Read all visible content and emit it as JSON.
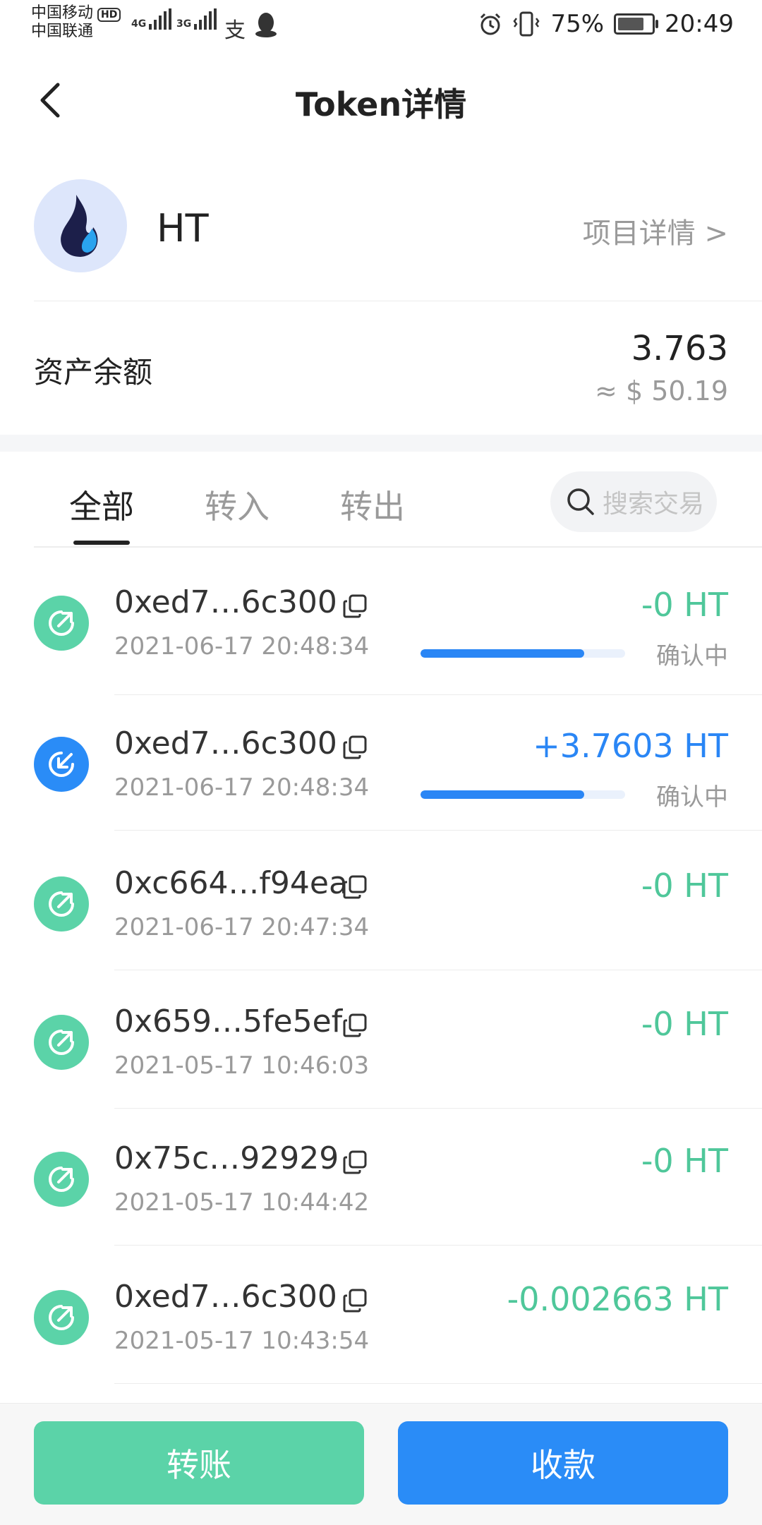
{
  "status_bar": {
    "carrier1": "中国移动",
    "carrier2": "中国联通",
    "hd": "HD",
    "net1": "4G",
    "net2": "3G",
    "battery": "75%",
    "time": "20:49"
  },
  "header": {
    "title": "Token详情"
  },
  "token": {
    "name": "HT",
    "project_link": "项目详情 >",
    "balance_label": "资产余额",
    "balance": "3.763",
    "balance_usd": "≈ $ 50.19"
  },
  "tabs": [
    {
      "label": "全部",
      "active": true
    },
    {
      "label": "转入",
      "active": false
    },
    {
      "label": "转出",
      "active": false
    }
  ],
  "search": {
    "placeholder": "搜索交易"
  },
  "transactions": [
    {
      "hash": "0xed7…6c300",
      "time": "2021-06-17 20:48:34",
      "amount": "-0 HT",
      "direction": "out",
      "status": "确认中",
      "progress": 0.8
    },
    {
      "hash": "0xed7…6c300",
      "time": "2021-06-17 20:48:34",
      "amount": "+3.7603 HT",
      "direction": "in",
      "status": "确认中",
      "progress": 0.8
    },
    {
      "hash": "0xc664…f94ea",
      "time": "2021-06-17 20:47:34",
      "amount": "-0 HT",
      "direction": "out",
      "status": "",
      "progress": null
    },
    {
      "hash": "0x659…5fe5ef",
      "time": "2021-05-17 10:46:03",
      "amount": "-0 HT",
      "direction": "out",
      "status": "",
      "progress": null
    },
    {
      "hash": "0x75c…92929",
      "time": "2021-05-17 10:44:42",
      "amount": "-0 HT",
      "direction": "out",
      "status": "",
      "progress": null
    },
    {
      "hash": "0xed7…6c300",
      "time": "2021-05-17 10:43:54",
      "amount": "-0.002663 HT",
      "direction": "out",
      "status": "",
      "progress": null
    }
  ],
  "actions": {
    "transfer": "转账",
    "receive": "收款"
  },
  "colors": {
    "green": "#5bd3a8",
    "blue": "#2a8cf7",
    "in_text": "#2a86f5",
    "out_text": "#4fc79a"
  }
}
